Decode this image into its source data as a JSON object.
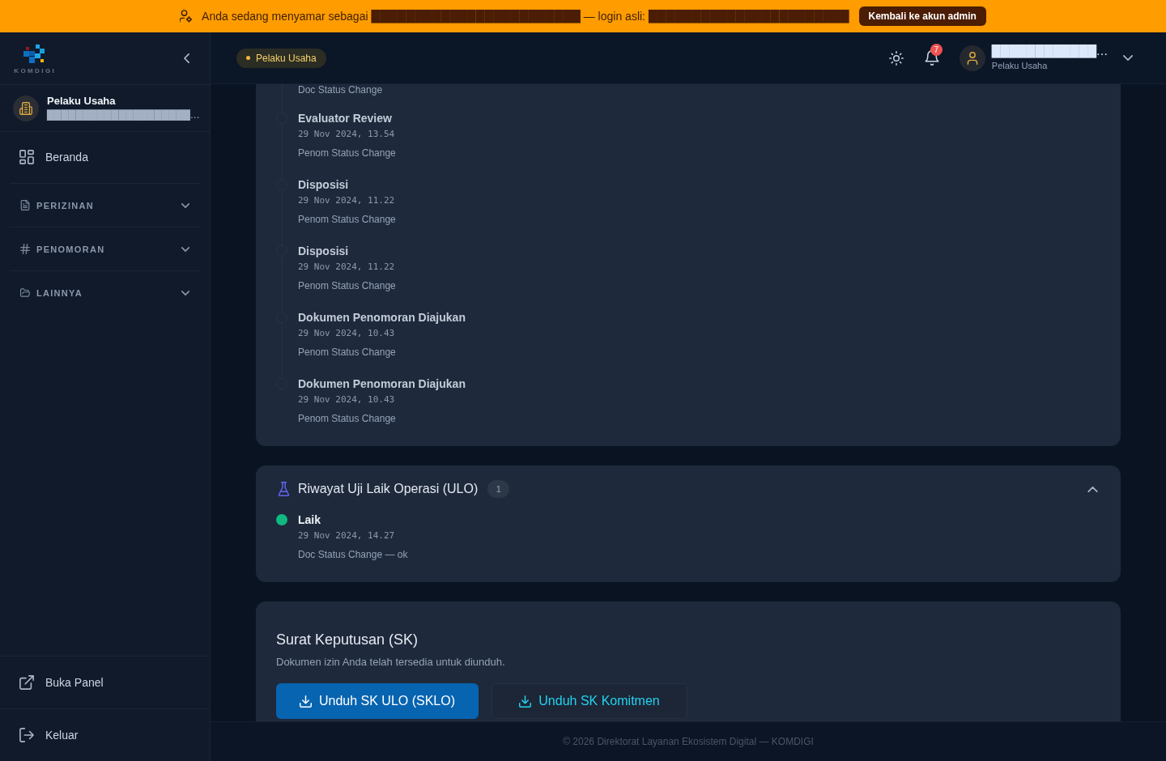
{
  "banner": {
    "before": "Anda sedang menyamar sebagai",
    "impersonated_user": "████████████████████████",
    "middle": "— login asli:",
    "real_login": "███████████████████████",
    "button": "Kembali ke akun admin"
  },
  "sidebar": {
    "logo_text": "KOMDIGI",
    "profile": {
      "role": "Pelaku Usaha",
      "name": "████████████████████…"
    },
    "home": "Beranda",
    "sections": [
      {
        "label": "PERIZINAN",
        "expanded": false
      },
      {
        "label": "PENOMORAN",
        "expanded": false
      },
      {
        "label": "LAINNYA",
        "expanded": false
      }
    ],
    "bottom_links": [
      "Buka Panel",
      "Keluar"
    ]
  },
  "header": {
    "role_badge": "Pelaku Usaha",
    "notifications": "7",
    "user": {
      "name": "████████████…",
      "role": "Pelaku Usaha"
    }
  },
  "activity": {
    "events": [
      {
        "description": "Doc Status Change"
      },
      {
        "title": "Evaluator Review",
        "date": "29 Nov 2024, 13.54",
        "description": "Penom Status Change"
      },
      {
        "title": "Disposisi",
        "date": "29 Nov 2024, 11.22",
        "description": "Penom Status Change"
      },
      {
        "title": "Disposisi",
        "date": "29 Nov 2024, 11.22",
        "description": "Penom Status Change"
      },
      {
        "title": "Dokumen Penomoran Diajukan",
        "date": "29 Nov 2024, 10.43",
        "description": "Penom Status Change"
      },
      {
        "title": "Dokumen Penomoran Diajukan",
        "date": "29 Nov 2024, 10.43",
        "description": "Penom Status Change"
      }
    ]
  },
  "ulo": {
    "title": "Riwayat Uji Laik Operasi (ULO)",
    "count": "1",
    "expanded": true,
    "events": [
      {
        "title": "Laik",
        "date": "29 Nov 2024, 14.27",
        "description": "Doc Status Change — ok",
        "color": "#10b981"
      }
    ]
  },
  "sk": {
    "title": "Surat Keputusan (SK)",
    "subtitle": "Dokumen izin Anda telah tersedia untuk diunduh.",
    "buttons": [
      {
        "label": "Unduh SK ULO (SKLO)",
        "kind": "primary"
      },
      {
        "label": "Unduh SK Komitmen",
        "kind": "secondary"
      }
    ]
  },
  "footer": "© 2026 Direktorat Layanan Ekosistem Digital — KOMDIGI"
}
